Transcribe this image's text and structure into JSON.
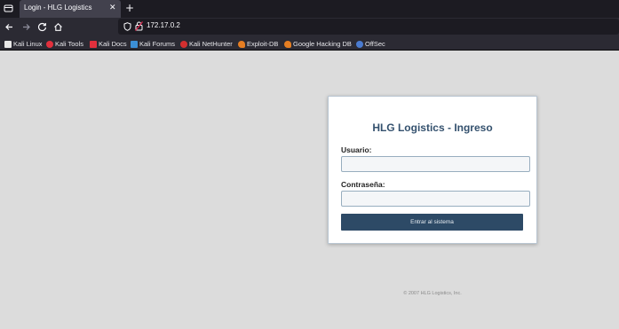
{
  "browser": {
    "tab_title": "Login - HLG Logistics",
    "tab_close": "✕",
    "new_tab": "+",
    "url": "172.17.0.2",
    "bookmarks": [
      {
        "label": "Kali Linux",
        "icon": "kali-dragon-icon",
        "color": "#e8e8e8"
      },
      {
        "label": "Kali Tools",
        "icon": "kali-tools-icon",
        "color": "#e2303d"
      },
      {
        "label": "Kali Docs",
        "icon": "kali-docs-icon",
        "color": "#e2303d"
      },
      {
        "label": "Kali Forums",
        "icon": "kali-forums-icon",
        "color": "#3b8fd6"
      },
      {
        "label": "Kali NetHunter",
        "icon": "nethunter-icon",
        "color": "#d32f2f"
      },
      {
        "label": "Exploit-DB",
        "icon": "exploit-db-icon",
        "color": "#e67e22"
      },
      {
        "label": "Google Hacking DB",
        "icon": "ghdb-icon",
        "color": "#e67e22"
      },
      {
        "label": "OffSec",
        "icon": "offsec-icon",
        "color": "#4a7bd0"
      }
    ]
  },
  "login": {
    "title": "HLG Logistics - Ingreso",
    "username_label": "Usuario:",
    "username_value": "",
    "password_label": "Contraseña:",
    "password_value": "",
    "submit_label": "Entrar al sistema"
  },
  "footer": {
    "text": "© 2007 HLG Logistics, Inc."
  },
  "colors": {
    "accent": "#2d4a66",
    "title": "#34516e",
    "page_bg": "#dcdcdc"
  }
}
